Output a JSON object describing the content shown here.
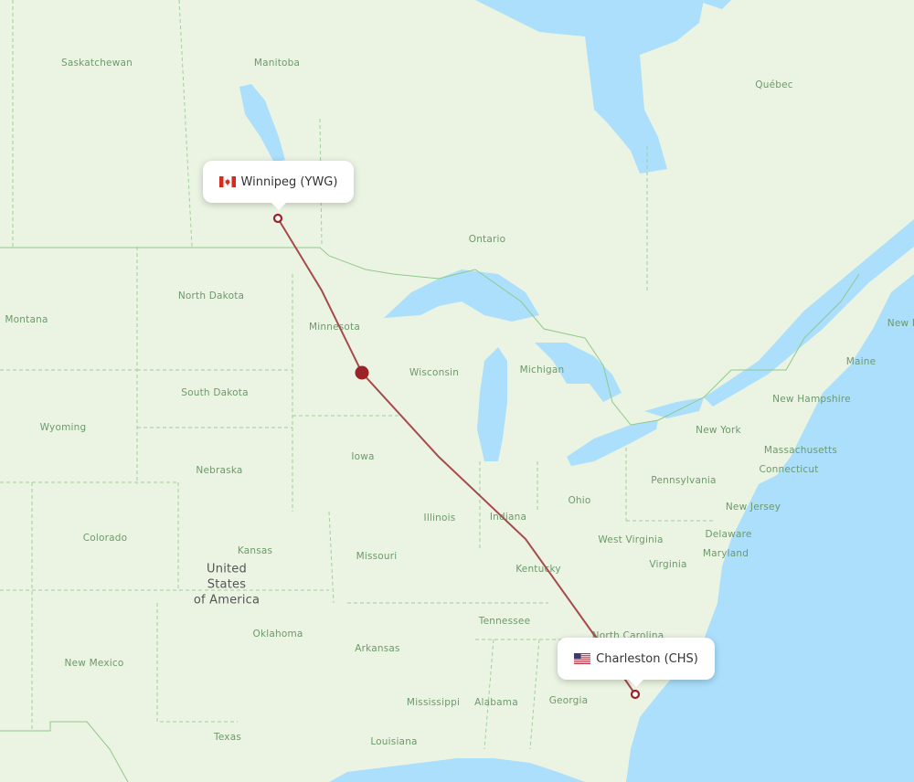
{
  "route": {
    "origin": {
      "city": "Winnipeg",
      "code": "YWG",
      "label": "Winnipeg (YWG)",
      "country_flag": "canada-flag"
    },
    "destination": {
      "city": "Charleston",
      "code": "CHS",
      "label": "Charleston (CHS)",
      "country_flag": "usa-flag"
    },
    "line_color": "#a64b4b",
    "marker_color": "#9b2226"
  },
  "colors": {
    "land": "#ebf4e3",
    "water": "#abdffb",
    "label": "#6c9a6a",
    "border": "#8fc98a"
  },
  "labels": {
    "regions": [
      {
        "name": "Saskatchewan"
      },
      {
        "name": "Manitoba"
      },
      {
        "name": "Québec"
      },
      {
        "name": "Ontario"
      },
      {
        "name": "North Dakota"
      },
      {
        "name": "Montana"
      },
      {
        "name": "Minnesota"
      },
      {
        "name": "Wisconsin"
      },
      {
        "name": "Michigan"
      },
      {
        "name": "South Dakota"
      },
      {
        "name": "Wyoming"
      },
      {
        "name": "Iowa"
      },
      {
        "name": "Nebraska"
      },
      {
        "name": "Illinois"
      },
      {
        "name": "Indiana"
      },
      {
        "name": "Ohio"
      },
      {
        "name": "Pennsylvania"
      },
      {
        "name": "New York"
      },
      {
        "name": "Maine"
      },
      {
        "name": "New Hampshire"
      },
      {
        "name": "Massachusetts"
      },
      {
        "name": "Connecticut"
      },
      {
        "name": "New Jersey"
      },
      {
        "name": "Delaware"
      },
      {
        "name": "Maryland"
      },
      {
        "name": "West Virginia"
      },
      {
        "name": "Virginia"
      },
      {
        "name": "Kentucky"
      },
      {
        "name": "Colorado"
      },
      {
        "name": "Kansas"
      },
      {
        "name": "Missouri"
      },
      {
        "name": "Tennessee"
      },
      {
        "name": "North Carolina"
      },
      {
        "name": "Oklahoma"
      },
      {
        "name": "Arkansas"
      },
      {
        "name": "New Mexico"
      },
      {
        "name": "Mississippi"
      },
      {
        "name": "Alabama"
      },
      {
        "name": "Georgia"
      },
      {
        "name": "Texas"
      },
      {
        "name": "Louisiana"
      },
      {
        "name": "New B"
      }
    ],
    "country": "United\nStates\nof America"
  }
}
